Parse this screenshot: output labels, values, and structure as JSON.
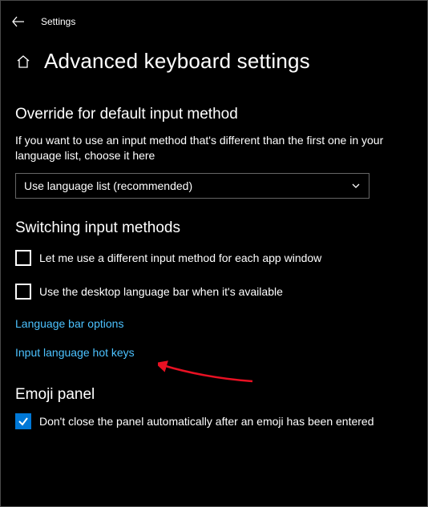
{
  "topbar": {
    "settings_label": "Settings"
  },
  "header": {
    "page_title": "Advanced keyboard settings"
  },
  "override": {
    "heading": "Override for default input method",
    "description": "If you want to use an input method that's different than the first one in your language list, choose it here",
    "dropdown_value": "Use language list (recommended)"
  },
  "switching": {
    "heading": "Switching input methods",
    "check1_label": "Let me use a different input method for each app window",
    "check2_label": "Use the desktop language bar when it's available",
    "link1": "Language bar options",
    "link2": "Input language hot keys"
  },
  "emoji": {
    "heading": "Emoji panel",
    "check_label": "Don't close the panel automatically after an emoji has been entered"
  }
}
